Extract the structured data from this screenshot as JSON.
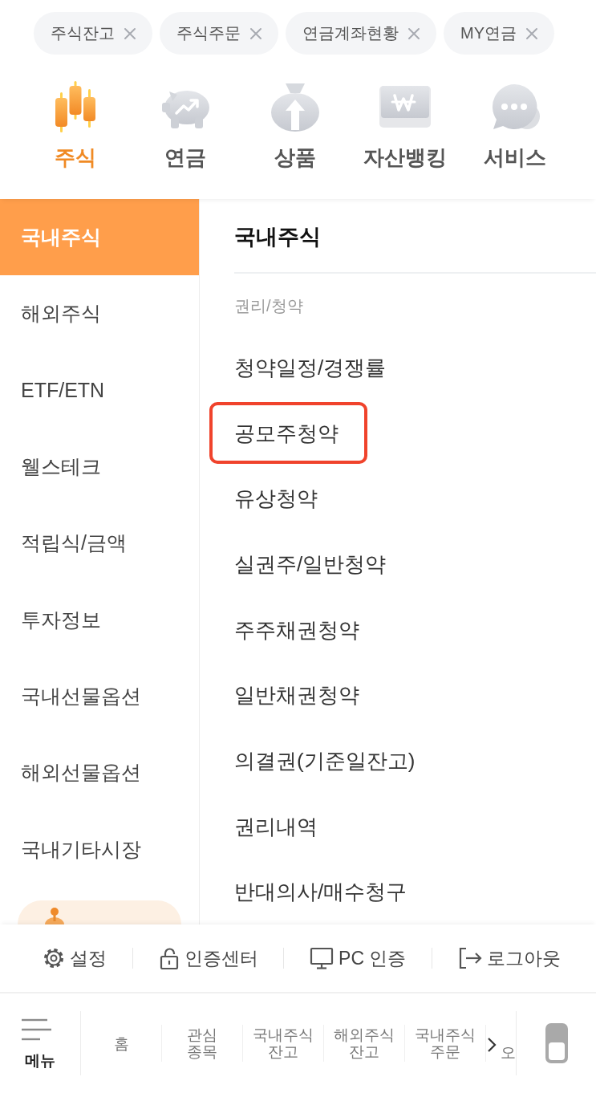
{
  "quick_tabs": [
    {
      "label": "주식잔고"
    },
    {
      "label": "주식주문"
    },
    {
      "label": "연금계좌현황"
    },
    {
      "label": "MY연금"
    }
  ],
  "categories": [
    {
      "label": "주식",
      "selected": true
    },
    {
      "label": "연금",
      "selected": false
    },
    {
      "label": "상품",
      "selected": false
    },
    {
      "label": "자산뱅킹",
      "selected": false
    },
    {
      "label": "서비스",
      "selected": false
    }
  ],
  "sidebar": {
    "items": [
      {
        "label": "국내주식",
        "selected": true
      },
      {
        "label": "해외주식",
        "selected": false
      },
      {
        "label": "ETF/ETN",
        "selected": false
      },
      {
        "label": "웰스테크",
        "selected": false
      },
      {
        "label": "적립식/금액",
        "selected": false
      },
      {
        "label": "투자정보",
        "selected": false
      },
      {
        "label": "국내선물옵션",
        "selected": false
      },
      {
        "label": "해외선물옵션",
        "selected": false
      },
      {
        "label": "국내기타시장",
        "selected": false
      }
    ]
  },
  "panel": {
    "title": "국내주식",
    "section": "권리/청약",
    "items": [
      {
        "label": "청약일정/경쟁률",
        "highlighted": false
      },
      {
        "label": "공모주청약",
        "highlighted": true
      },
      {
        "label": "유상청약",
        "highlighted": false
      },
      {
        "label": "실권주/일반청약",
        "highlighted": false
      },
      {
        "label": "주주채권청약",
        "highlighted": false
      },
      {
        "label": "일반채권청약",
        "highlighted": false
      },
      {
        "label": "의결권(기준일잔고)",
        "highlighted": false
      },
      {
        "label": "권리내역",
        "highlighted": false
      },
      {
        "label": "반대의사/매수청구",
        "highlighted": false
      }
    ]
  },
  "footer_links": [
    {
      "label": "설정"
    },
    {
      "label": "인증센터"
    },
    {
      "label": "PC 인증"
    },
    {
      "label": "로그아웃"
    }
  ],
  "bottom_nav": {
    "menu_label": "메뉴",
    "items": [
      {
        "label": "홈"
      },
      {
        "label": "관심\n종목"
      },
      {
        "label": "국내주식\n잔고"
      },
      {
        "label": "해외주식\n잔고"
      },
      {
        "label": "국내주식\n주문"
      },
      {
        "label": "오"
      }
    ]
  }
}
